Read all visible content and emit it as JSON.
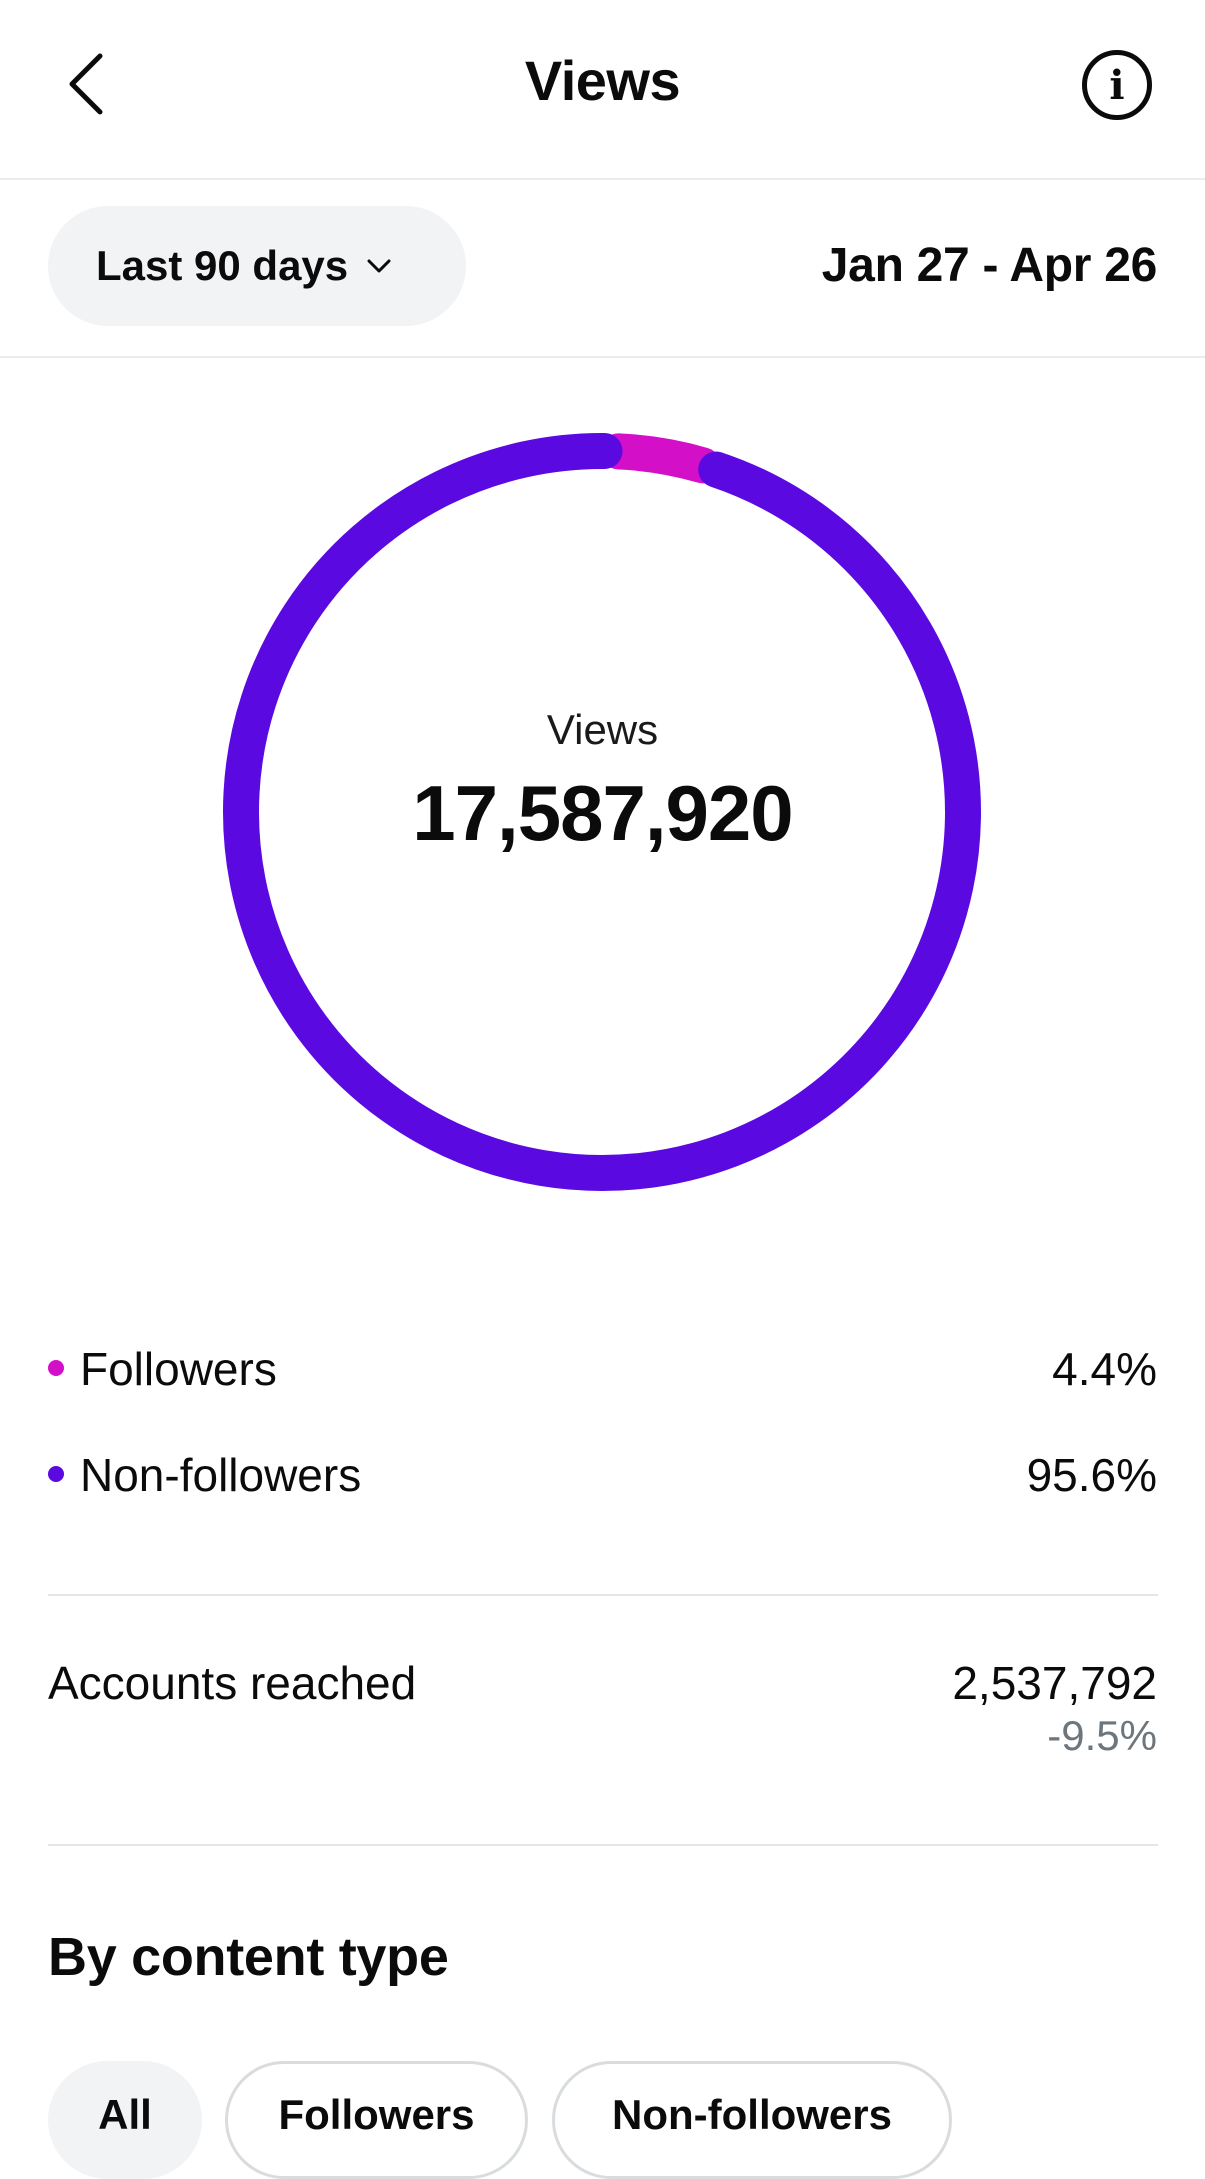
{
  "header": {
    "title": "Views",
    "back_icon": "chevron-left-icon",
    "info_icon": "info-icon"
  },
  "filter": {
    "range_label": "Last 90 days",
    "date_range": "Jan 27 - Apr 26"
  },
  "chart_data": {
    "type": "pie",
    "categories": [
      "Followers",
      "Non-followers"
    ],
    "values": [
      4.4,
      95.6
    ],
    "colors": [
      "#d40fc8",
      "#5a0ae0"
    ],
    "center_label": "Views",
    "center_value": "17,587,920"
  },
  "legend": [
    {
      "name": "Followers",
      "pct": "4.4%",
      "color": "#d40fc8"
    },
    {
      "name": "Non-followers",
      "pct": "95.6%",
      "color": "#5a0ae0"
    }
  ],
  "accounts": {
    "label": "Accounts reached",
    "value": "2,537,792",
    "change": "-9.5%"
  },
  "section": {
    "title": "By content type"
  },
  "chips": [
    {
      "label": "All",
      "active": true
    },
    {
      "label": "Followers",
      "active": false
    },
    {
      "label": "Non-followers",
      "active": false
    }
  ]
}
